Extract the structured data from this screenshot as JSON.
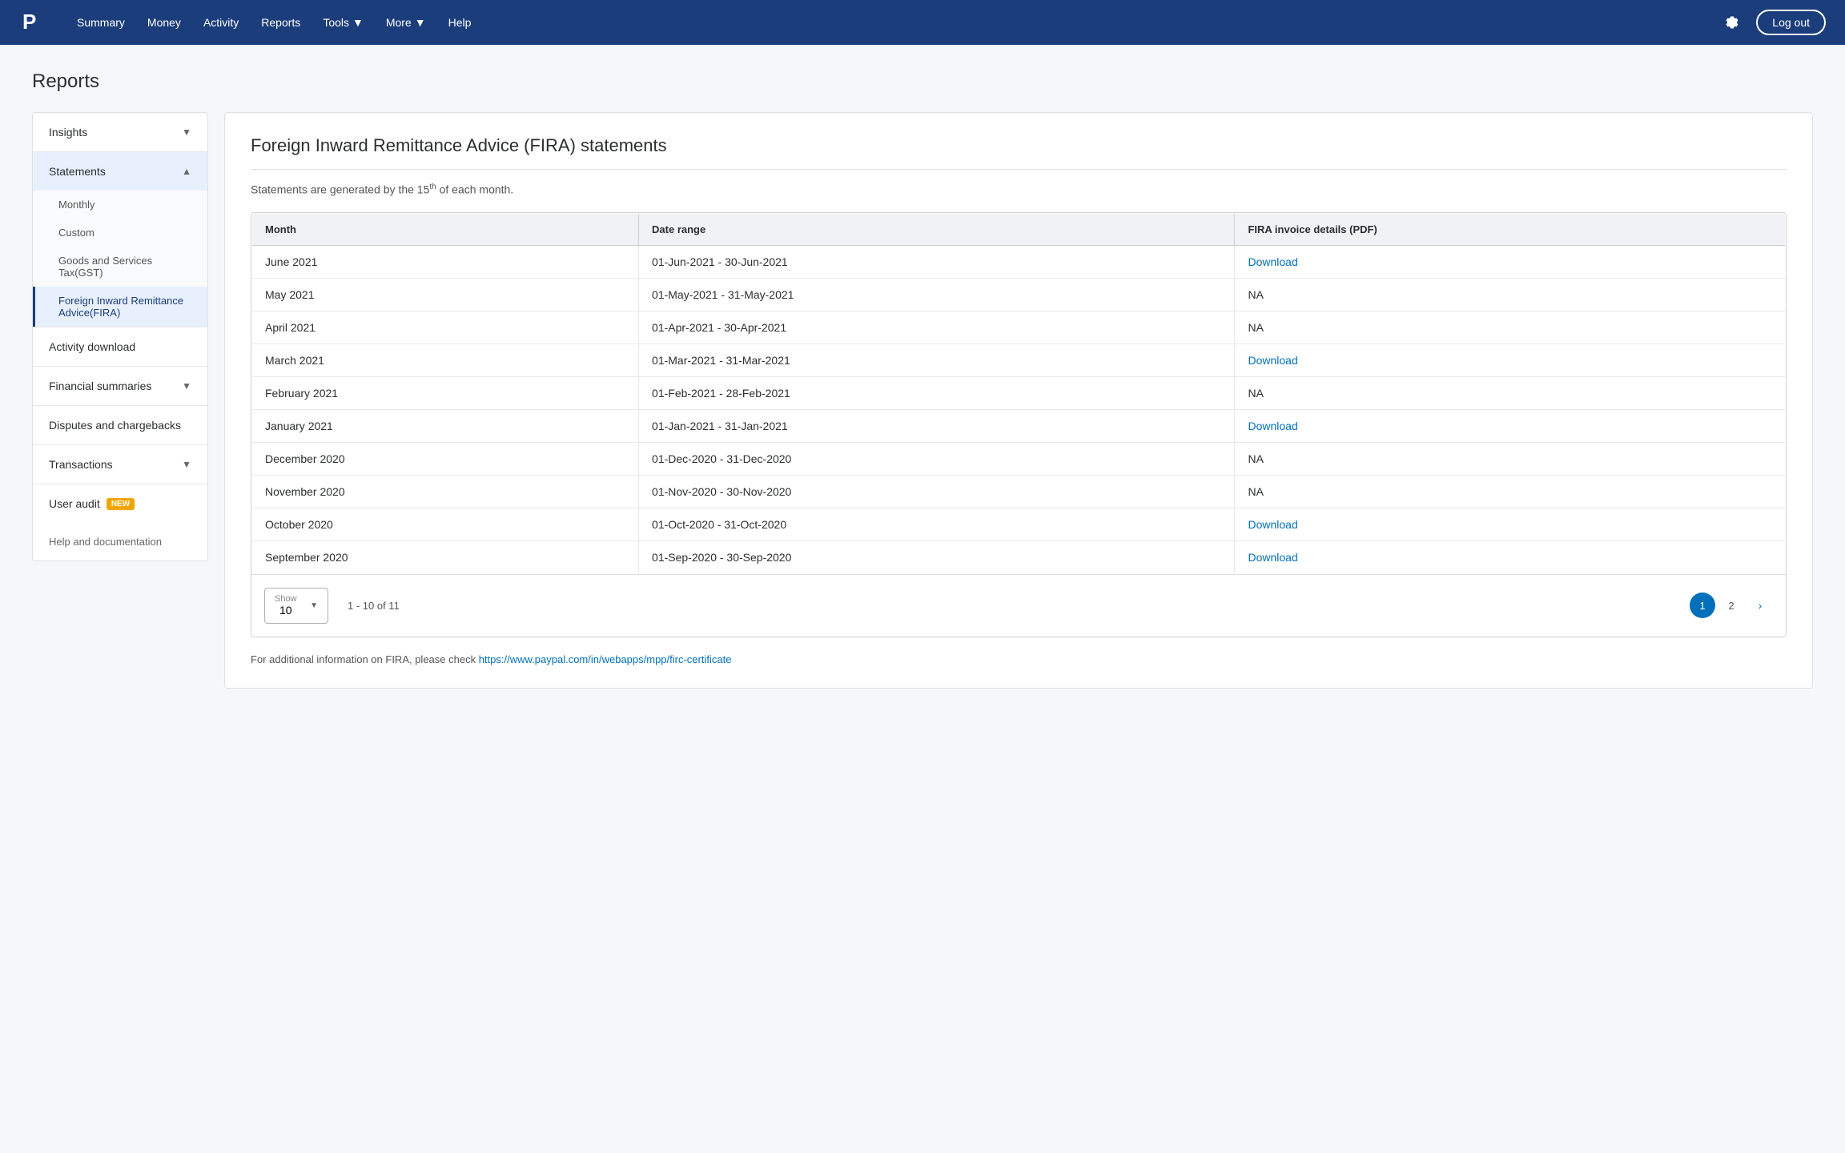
{
  "header": {
    "nav_items": [
      {
        "label": "Summary",
        "has_dropdown": false
      },
      {
        "label": "Money",
        "has_dropdown": false
      },
      {
        "label": "Activity",
        "has_dropdown": false
      },
      {
        "label": "Reports",
        "has_dropdown": false
      },
      {
        "label": "Tools",
        "has_dropdown": true
      },
      {
        "label": "More",
        "has_dropdown": true
      },
      {
        "label": "Help",
        "has_dropdown": false
      }
    ],
    "logout_label": "Log out"
  },
  "page": {
    "title": "Reports"
  },
  "sidebar": {
    "sections": [
      {
        "label": "Insights",
        "expanded": false,
        "sub_items": []
      },
      {
        "label": "Statements",
        "expanded": true,
        "sub_items": [
          {
            "label": "Monthly",
            "active": false
          },
          {
            "label": "Custom",
            "active": false
          },
          {
            "label": "Goods and Services Tax(GST)",
            "active": false
          },
          {
            "label": "Foreign Inward Remittance Advice(FIRA)",
            "active": true
          }
        ]
      },
      {
        "label": "Activity download",
        "plain": true
      },
      {
        "label": "Financial summaries",
        "expanded": false,
        "sub_items": []
      },
      {
        "label": "Disputes and chargebacks",
        "plain": true
      },
      {
        "label": "Transactions",
        "expanded": false,
        "sub_items": []
      },
      {
        "label": "User audit",
        "plain": true,
        "badge": "NEW"
      }
    ],
    "help_label": "Help and documentation"
  },
  "content": {
    "title": "Foreign Inward Remittance Advice (FIRA) statements",
    "subtitle_pre": "Statements are generated by the 15",
    "subtitle_sup": "th",
    "subtitle_post": " of each month.",
    "table": {
      "columns": [
        "Month",
        "Date range",
        "FIRA invoice details (PDF)"
      ],
      "rows": [
        {
          "month": "June 2021",
          "date_range": "01-Jun-2021 - 30-Jun-2021",
          "pdf": "Download",
          "is_link": true
        },
        {
          "month": "May 2021",
          "date_range": "01-May-2021 - 31-May-2021",
          "pdf": "NA",
          "is_link": false
        },
        {
          "month": "April 2021",
          "date_range": "01-Apr-2021 - 30-Apr-2021",
          "pdf": "NA",
          "is_link": false
        },
        {
          "month": "March 2021",
          "date_range": "01-Mar-2021 - 31-Mar-2021",
          "pdf": "Download",
          "is_link": true
        },
        {
          "month": "February 2021",
          "date_range": "01-Feb-2021 - 28-Feb-2021",
          "pdf": "NA",
          "is_link": false
        },
        {
          "month": "January 2021",
          "date_range": "01-Jan-2021 - 31-Jan-2021",
          "pdf": "Download",
          "is_link": true
        },
        {
          "month": "December 2020",
          "date_range": "01-Dec-2020 - 31-Dec-2020",
          "pdf": "NA",
          "is_link": false
        },
        {
          "month": "November 2020",
          "date_range": "01-Nov-2020 - 30-Nov-2020",
          "pdf": "NA",
          "is_link": false
        },
        {
          "month": "October 2020",
          "date_range": "01-Oct-2020 - 31-Oct-2020",
          "pdf": "Download",
          "is_link": true
        },
        {
          "month": "September 2020",
          "date_range": "01-Sep-2020 - 30-Sep-2020",
          "pdf": "Download",
          "is_link": true
        }
      ]
    },
    "pagination": {
      "show_label": "Show",
      "show_value": "10",
      "range_text": "1 - 10 of 11",
      "pages": [
        "1",
        "2"
      ],
      "active_page": "1"
    },
    "footer_note_pre": "For additional information on FIRA, please check ",
    "footer_link": "https://www.paypal.com/in/webapps/mpp/firc-certificate",
    "footer_link_label": "https://www.paypal.com/in/webapps/mpp/firc-certificate"
  }
}
